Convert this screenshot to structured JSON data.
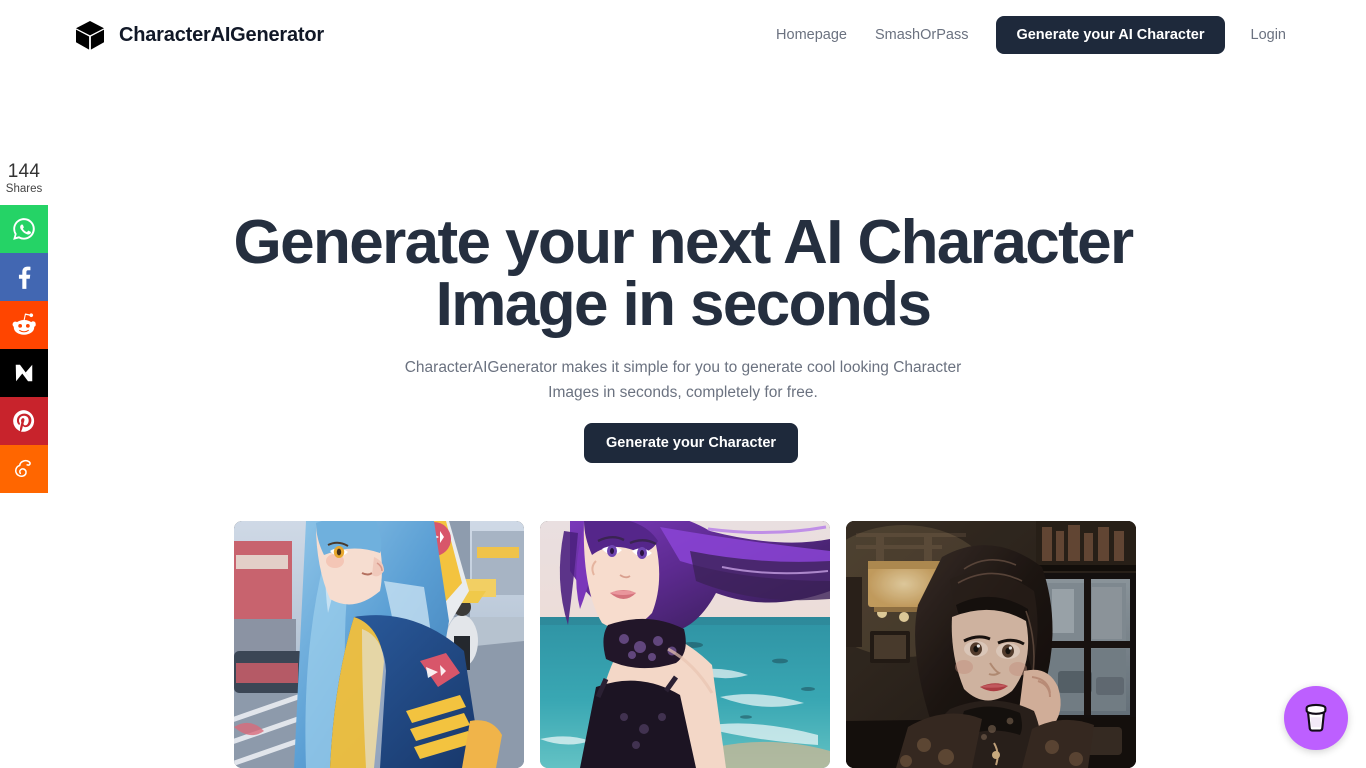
{
  "header": {
    "brand_name": "CharacterAIGenerator",
    "logo_icon": "cube-icon",
    "nav": [
      {
        "label": "Homepage",
        "name": "nav-link-homepage"
      },
      {
        "label": "SmashOrPass",
        "name": "nav-link-smashorpass"
      }
    ],
    "cta_label": "Generate your AI Character",
    "login_label": "Login"
  },
  "share_rail": {
    "count": "144",
    "count_label": "Shares",
    "buttons": [
      {
        "name": "whatsapp",
        "label": "WhatsApp",
        "color": "#25d366"
      },
      {
        "name": "facebook",
        "label": "Facebook",
        "color": "#4267b2"
      },
      {
        "name": "reddit",
        "label": "Reddit",
        "color": "#ff4500"
      },
      {
        "name": "x",
        "label": "X",
        "color": "#000000"
      },
      {
        "name": "pinterest",
        "label": "Pinterest",
        "color": "#c8232c"
      },
      {
        "name": "mix",
        "label": "Mix",
        "color": "#ff6600"
      }
    ]
  },
  "hero": {
    "title": "Generate your next AI Character Image in seconds",
    "subtitle": "CharacterAIGenerator makes it simple for you to generate cool looking Character Images in seconds, completely for free.",
    "cta_label": "Generate your Character"
  },
  "gallery": {
    "cards": [
      {
        "name": "character-card-1",
        "alt": "Anime girl with blue hair wearing a blue and yellow hoodie on a city street"
      },
      {
        "name": "character-card-2",
        "alt": "Anime girl with flowing purple hair and black lace choker at the ocean"
      },
      {
        "name": "character-card-3",
        "alt": "Realistic dark haired girl with lace top sitting in a cafe"
      }
    ]
  },
  "floating_action": {
    "name": "buy-me-a-coffee-button",
    "icon": "coffee-cup-icon",
    "color": "#bd5fff"
  },
  "colors": {
    "background": "#ffffff",
    "heading": "#252f3f",
    "body_text": "#6b7280",
    "button_dark": "#1e293b"
  }
}
